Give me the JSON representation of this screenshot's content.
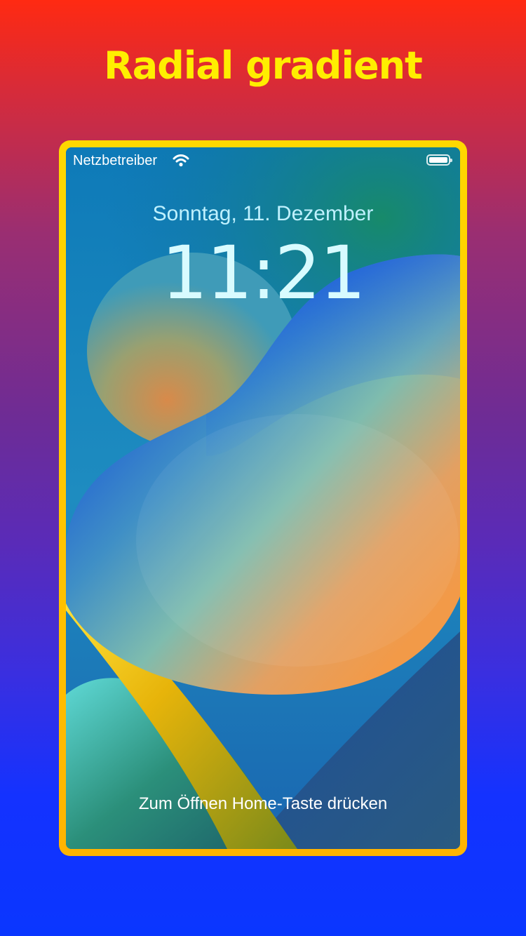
{
  "headline": "Radial gradient",
  "statusbar": {
    "carrier": "Netzbetreiber",
    "wifi_icon": "wifi-icon",
    "battery_icon": "battery-icon"
  },
  "lockscreen": {
    "date": "Sonntag, 11. Dezember",
    "time": "11:21",
    "unlock_hint": "Zum Öffnen Home-Taste drücken"
  },
  "colors": {
    "headline": "#ffee00",
    "frame": "#ffd800",
    "background_top": "#ff2a12",
    "background_bottom": "#0a36ff"
  }
}
